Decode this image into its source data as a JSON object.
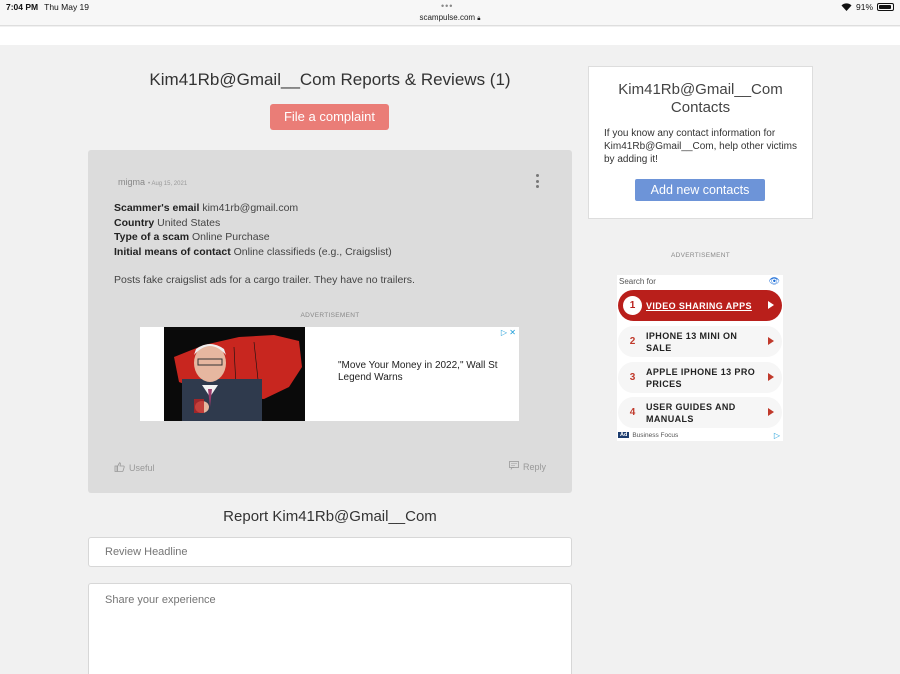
{
  "status_bar": {
    "time": "7:04 PM",
    "date": "Thu May 19",
    "url": "scampulse.com",
    "battery": "91%",
    "battery_level": 0.91
  },
  "page": {
    "title": "Kim41Rb@Gmail__Com Reports & Reviews (1)",
    "complaint_button": "File a complaint"
  },
  "review": {
    "author": "migma",
    "date": "• Aug 15, 2021",
    "fields": [
      {
        "label": "Scammer's email",
        "value": "kim41rb@gmail.com"
      },
      {
        "label": "Country",
        "value": "United States"
      },
      {
        "label": "Type of a scam",
        "value": "Online Purchase"
      },
      {
        "label": "Initial means of contact",
        "value": "Online classifieds (e.g., Craigslist)"
      }
    ],
    "description": "Posts fake craigslist ads for a cargo trailer. They have no trailers.",
    "ad_label": "ADVERTISEMENT",
    "ad_headline": "\"Move Your Money in 2022,\" Wall St Legend Warns",
    "useful_label": "Useful",
    "reply_label": "Reply"
  },
  "report_form": {
    "title": "Report Kim41Rb@Gmail__Com",
    "headline_placeholder": "Review Headline",
    "experience_placeholder": "Share your experience"
  },
  "contacts": {
    "title": "Kim41Rb@Gmail__Com Contacts",
    "text": "If you know any contact information for Kim41Rb@Gmail__Com, help other victims by adding it!",
    "add_button": "Add new contacts"
  },
  "side_ad": {
    "label": "ADVERTISEMENT",
    "search_for": "Search for",
    "items": [
      {
        "num": "1",
        "label": "VIDEO SHARING APPS"
      },
      {
        "num": "2",
        "label": "IPHONE 13 MINI ON SALE"
      },
      {
        "num": "3",
        "label": "APPLE IPHONE 13 PRO PRICES"
      },
      {
        "num": "4",
        "label": "USER GUIDES AND MANUALS"
      }
    ],
    "footer_badge": "Ad",
    "footer": "Business Focus"
  },
  "colors": {
    "complaint_button": "#ea7d77",
    "add_contacts_button": "#6d94d8",
    "ad_accent": "#b91f1b"
  }
}
